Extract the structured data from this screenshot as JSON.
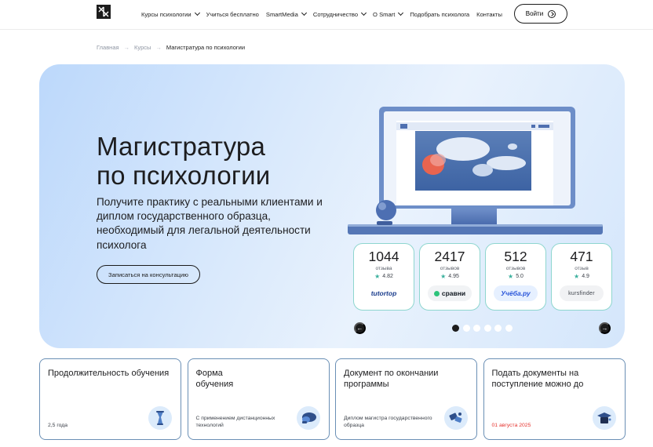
{
  "header": {
    "nav": [
      {
        "label": "Курсы психологии",
        "has_dropdown": true
      },
      {
        "label": "Учиться бесплатно",
        "has_dropdown": false
      },
      {
        "label": "SmartMedia",
        "has_dropdown": true
      },
      {
        "label": "Сотрудничество",
        "has_dropdown": true
      },
      {
        "label": "О Smart",
        "has_dropdown": true
      },
      {
        "label": "Подобрать психолога",
        "has_dropdown": false
      },
      {
        "label": "Контакты",
        "has_dropdown": false
      }
    ],
    "login_label": "Войти"
  },
  "breadcrumb": {
    "items": [
      "Главная",
      "Курсы"
    ],
    "separator": "→",
    "current": "Магистратура по психологии"
  },
  "hero": {
    "title_line1": "Магистратура",
    "title_line2": "по психологии",
    "subtitle": "Получите практику с реальными клиентами и диплом государственного образца, необходимый для легальной деятельности психолога",
    "cta_label": "Записаться на консультацию",
    "arrow_prev": "←",
    "arrow_next": "→",
    "slides_total": 6,
    "slide_active": 1
  },
  "reviews": [
    {
      "count": "1044",
      "label": "отзыва",
      "rating": "4.82",
      "platform": "tutortop",
      "icon": "star-icon"
    },
    {
      "count": "2417",
      "label": "отзывов",
      "rating": "4.95",
      "platform": "сравни",
      "icon": "star-icon"
    },
    {
      "count": "512",
      "label": "отзывов",
      "rating": "5.0",
      "platform": "Учёба.ру",
      "icon": "star-icon"
    },
    {
      "count": "471",
      "label": "отзыв",
      "rating": "4.9",
      "platform": "kursfinder",
      "icon": "star-icon"
    }
  ],
  "info_cards": [
    {
      "title": "Продолжительность обучения",
      "value": "2,5 года",
      "icon": "hourglass-icon"
    },
    {
      "title": "Форма обучения",
      "value": "С применением дистанционных технологий",
      "icon": "cloud-chat-icon"
    },
    {
      "title": "Документ по окончании программы",
      "value": "Диплом магистра государственного образца",
      "icon": "document-icon"
    },
    {
      "title": "Подать документы на поступление можно до",
      "value": "01 августа 2025",
      "icon": "graduation-cap-icon",
      "value_color": "#e5322d"
    }
  ],
  "colors": {
    "accent_teal": "#8ed6cf",
    "star": "#3bb09d",
    "deadline_red": "#e5322d",
    "hero_bg": "#d9e9fc"
  }
}
